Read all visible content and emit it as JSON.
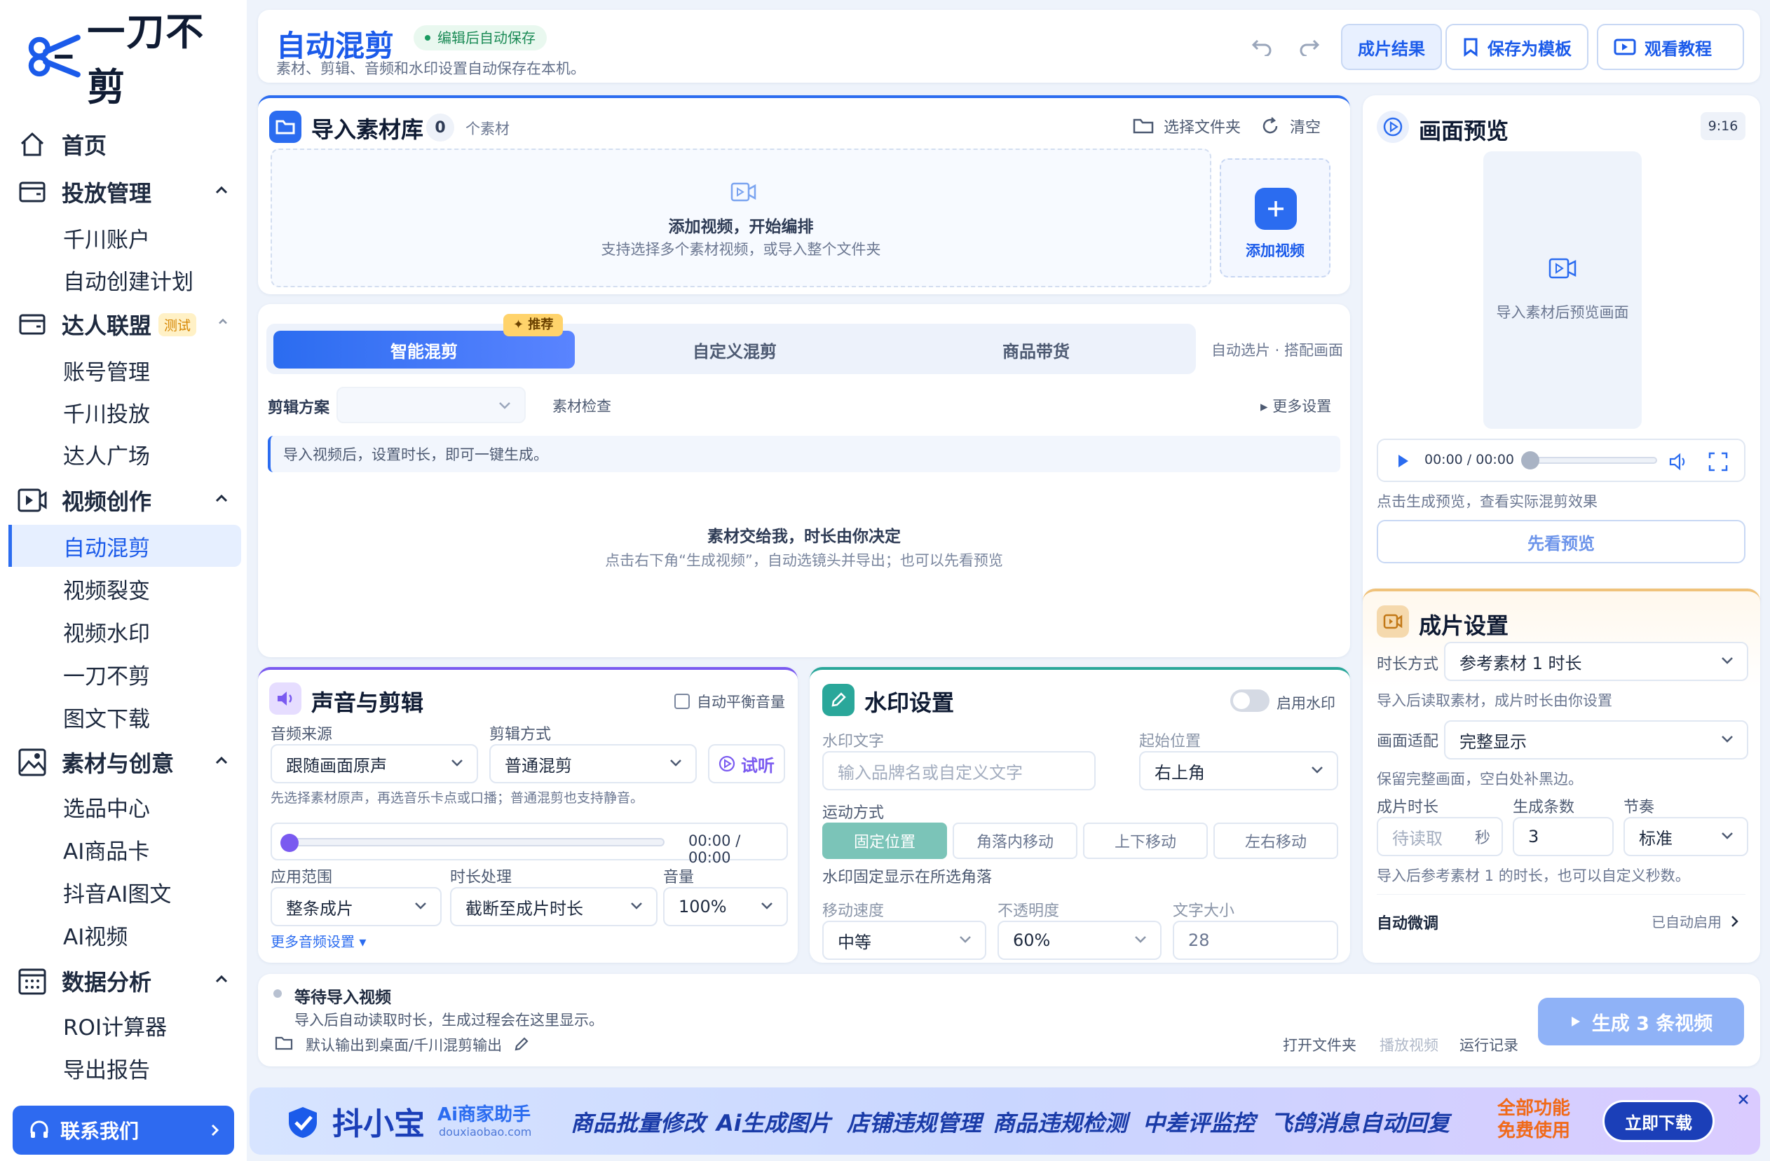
{
  "sidebar": {
    "logo_text": "一刀不剪",
    "nav": [
      {
        "label": "首页",
        "icon": "home-icon"
      },
      {
        "label": "投放管理",
        "icon": "wallet-icon",
        "children": [
          "千川账户",
          "自动创建计划"
        ]
      },
      {
        "label": "达人联盟",
        "icon": "wallet-icon",
        "badge": "测试",
        "children": [
          "账号管理",
          "千川投放",
          "达人广场"
        ]
      },
      {
        "label": "视频创作",
        "icon": "video-icon",
        "children": [
          "自动混剪",
          "视频裂变",
          "视频水印",
          "一刀不剪",
          "图文下载"
        ]
      },
      {
        "label": "素材与创意",
        "icon": "image-icon",
        "children": [
          "选品中心",
          "AI商品卡",
          "抖音AI图文",
          "AI视频"
        ]
      },
      {
        "label": "数据分析",
        "icon": "calendar-icon",
        "children": [
          "ROI计算器",
          "导出报告"
        ]
      }
    ],
    "active": "自动混剪",
    "contact_label": "联系我们"
  },
  "header": {
    "title": "自动混剪",
    "badge": "编辑后自动保存",
    "subtitle": "素材、剪辑、音频和水印设置自动保存在本机。",
    "btn_results": "成片结果",
    "btn_save_template": "保存为模板",
    "btn_tutorial": "观看教程"
  },
  "import": {
    "title": "导入素材库",
    "count": "0",
    "count_unit": "个素材",
    "select_folder": "选择文件夹",
    "clear": "清空",
    "drop_title": "添加视频，开始编排",
    "drop_sub": "支持选择多个素材视频，或导入整个文件夹",
    "add_label": "添加视频"
  },
  "mix": {
    "tabs": [
      "智能混剪",
      "自定义混剪",
      "商品带货"
    ],
    "recommend": "推荐",
    "right_hint": "自动选片 · 搭配画面",
    "plan_label": "剪辑方案",
    "check_label": "素材检查",
    "more_settings": "更多设置",
    "info": "导入视频后，设置时长，即可一键生成。",
    "empty_title": "素材交给我，时长由你决定",
    "empty_sub": "点击右下角“生成视频”，自动选镜头并导出；也可以先看预览"
  },
  "audio": {
    "title": "声音与剪辑",
    "auto_balance": "自动平衡音量",
    "source_label": "音频来源",
    "source_value": "跟随画面原声",
    "mode_label": "剪辑方式",
    "mode_value": "普通混剪",
    "listen": "试听",
    "hint": "先选择素材原声，再选音乐卡点或口播；普通混剪也支持静音。",
    "time": "00:00 / 00:00",
    "progress": 0,
    "range_label": "应用范围",
    "range_value": "整条成片",
    "duration_label": "时长处理",
    "duration_value": "截断至成片时长",
    "volume_label": "音量",
    "volume_value": "100%",
    "more": "更多音频设置"
  },
  "watermark": {
    "title": "水印设置",
    "enable": "启用水印",
    "enabled": false,
    "text_label": "水印文字",
    "text_placeholder": "输入品牌名或自定义文字",
    "pos_label": "起始位置",
    "pos_value": "右上角",
    "motion_label": "运动方式",
    "motions": [
      "固定位置",
      "角落内移动",
      "上下移动",
      "左右移动"
    ],
    "motion_hint": "水印固定显示在所选角落",
    "speed_label": "移动速度",
    "speed_value": "中等",
    "opacity_label": "不透明度",
    "opacity_value": "60%",
    "size_label": "文字大小",
    "size_value": "28"
  },
  "preview": {
    "title": "画面预览",
    "ratio": "9:16",
    "placeholder": "导入素材后预览画面",
    "time": "00:00 / 00:00",
    "hint": "点击生成预览，查看实际混剪效果",
    "btn": "先看预览"
  },
  "output": {
    "title": "成片设置",
    "duration_mode_label": "时长方式",
    "duration_mode_value": "参考素材 1 时长",
    "duration_hint": "导入后读取素材，成片时长由你设置",
    "fit_label": "画面适配",
    "fit_value": "完整显示",
    "fit_hint": "保留完整画面，空白处补黑边。",
    "length_label": "成片时长",
    "length_placeholder": "待读取",
    "length_unit": "秒",
    "count_label": "生成条数",
    "count_value": "3",
    "rhythm_label": "节奏",
    "rhythm_value": "标准",
    "length_hint": "导入后参考素材 1 的时长，也可以自定义秒数。",
    "fine_tune": "自动微调",
    "fine_tune_status": "已自动启用"
  },
  "status": {
    "title": "等待导入视频",
    "sub": "导入后自动读取时长，生成过程会在这里显示。",
    "output_path": "默认输出到桌面/千川混剪输出",
    "open_folder": "打开文件夹",
    "play_video": "播放视频",
    "run_log": "运行记录",
    "generate": "生成 3 条视频"
  },
  "banner": {
    "brand": "抖小宝",
    "brand_sub": "Ai商家助手",
    "domain": "douxiaobao.com",
    "items": [
      "商品批量修改",
      "Ai生成图片",
      "店铺违规管理",
      "商品违规检测",
      "中差评监控",
      "飞鸽消息自动回复"
    ],
    "free_line1": "全部功能",
    "free_line2": "免费使用",
    "download": "立即下载"
  },
  "colors": {
    "accent": "#2b6cf0",
    "accent_dark": "#1b5bea",
    "purple": "#7a5af0",
    "teal": "#2aa79a",
    "orange": "#f0a84a"
  }
}
